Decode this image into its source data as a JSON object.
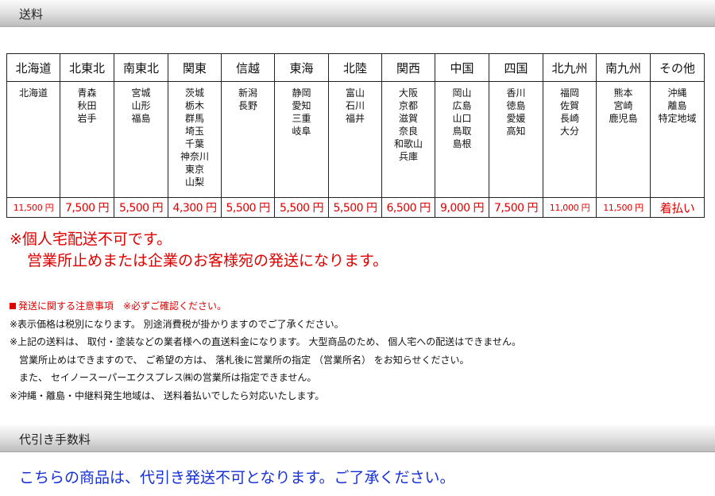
{
  "shipping_header": "送料",
  "columns": [
    "北海道",
    "北東北",
    "南東北",
    "関東",
    "信越",
    "東海",
    "北陸",
    "関西",
    "中国",
    "四国",
    "北九州",
    "南九州",
    "その他"
  ],
  "areas": [
    [
      "北海道"
    ],
    [
      "青森",
      "秋田",
      "岩手"
    ],
    [
      "宮城",
      "山形",
      "福島"
    ],
    [
      "茨城",
      "栃木",
      "群馬",
      "埼玉",
      "千葉",
      "神奈川",
      "東京",
      "山梨"
    ],
    [
      "新潟",
      "長野"
    ],
    [
      "静岡",
      "愛知",
      "三重",
      "岐阜"
    ],
    [
      "富山",
      "石川",
      "福井"
    ],
    [
      "大阪",
      "京都",
      "滋賀",
      "奈良",
      "和歌山",
      "兵庫"
    ],
    [
      "岡山",
      "広島",
      "山口",
      "鳥取",
      "島根"
    ],
    [
      "香川",
      "徳島",
      "愛媛",
      "高知"
    ],
    [
      "福岡",
      "佐賀",
      "長崎",
      "大分"
    ],
    [
      "熊本",
      "宮崎",
      "鹿児島"
    ],
    [
      "沖縄",
      "離島",
      "特定地域"
    ]
  ],
  "prices": [
    "11,500 円",
    "7,500 円",
    "5,500 円",
    "4,300 円",
    "5,500 円",
    "5,500 円",
    "5,500 円",
    "6,500 円",
    "9,000 円",
    "7,500 円",
    "11,000 円",
    "11,500 円",
    "着払い"
  ],
  "notice": {
    "line1": "※個人宅配送不可です。",
    "line2": "営業所止めまたは企業のお客様宛の発送になります。"
  },
  "notes": {
    "heading": "発送に関する注意事項　※必ずご確認ください。",
    "items": [
      "※表示価格は税別になります。 別途消費税が掛かりますのでご了承ください。",
      "※上記の送料は、 取付・塗装などの業者様への直送料金になります。 大型商品のため、 個人宅への配送はできません。",
      "営業所止めはできますので、 ご希望の方は、 落札後に営業所の指定 （営業所名） をお知らせください。",
      "また、 セイノースーパーエクスプレス㈱の営業所は指定できません。",
      "※沖縄・離島・中継料発生地域は、 送料着払いでしたら対応いたします。"
    ]
  },
  "cod_header": "代引き手数料",
  "cod_message": "こちらの商品は、代引き発送不可となります。ご了承ください。",
  "colors": {
    "red": "#e00000",
    "blue": "#1530d8"
  }
}
